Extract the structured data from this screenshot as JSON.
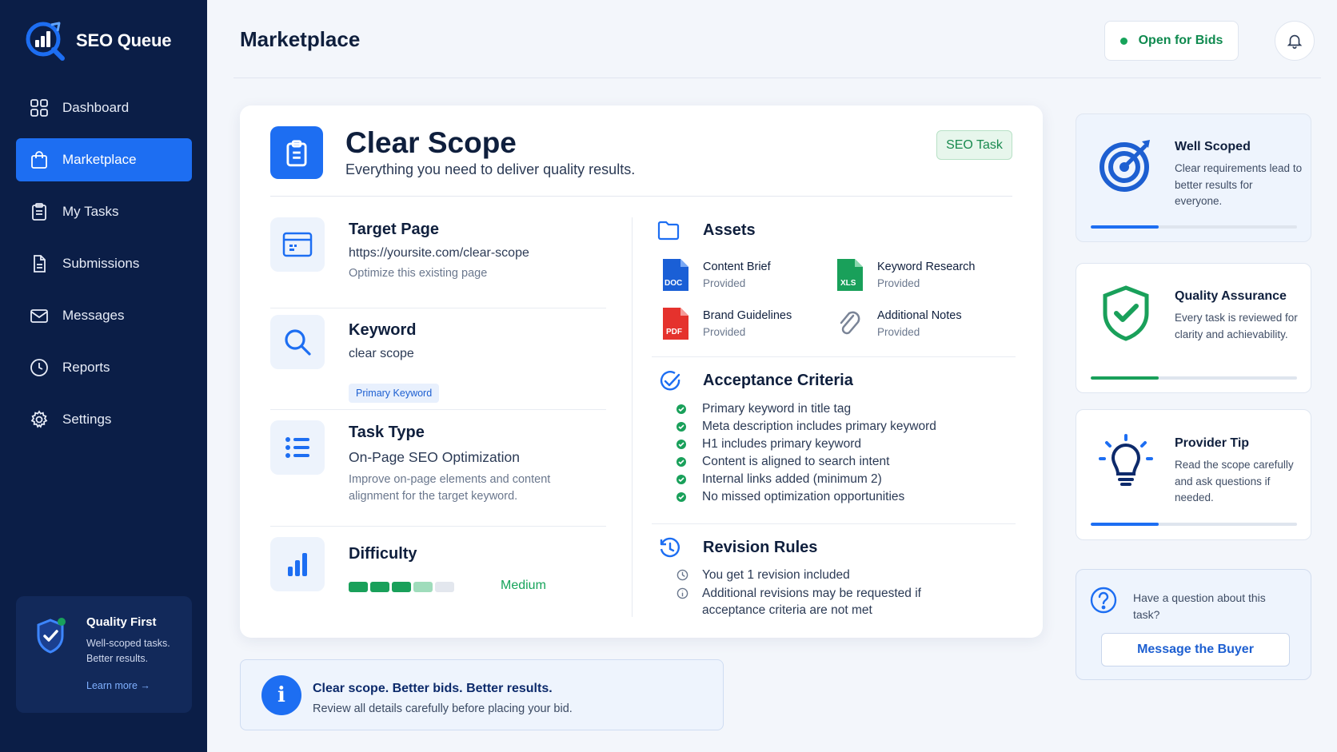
{
  "app": {
    "name": "SEO Queue"
  },
  "sidebar": {
    "items": [
      {
        "label": "Dashboard",
        "icon": "grid-icon",
        "active": false
      },
      {
        "label": "Marketplace",
        "icon": "shopping-bag-icon",
        "active": true
      },
      {
        "label": "My Tasks",
        "icon": "clipboard-icon",
        "active": false
      },
      {
        "label": "Submissions",
        "icon": "document-icon",
        "active": false
      },
      {
        "label": "Messages",
        "icon": "mail-icon",
        "active": false
      },
      {
        "label": "Reports",
        "icon": "clock-icon",
        "active": false
      },
      {
        "label": "Settings",
        "icon": "gear-icon",
        "active": false
      }
    ],
    "promo": {
      "title": "Quality First",
      "text": "Well-scoped tasks. Better results.",
      "link": "Learn more"
    }
  },
  "header": {
    "title": "Marketplace",
    "status": "Open for Bids"
  },
  "task": {
    "title": "Clear Scope",
    "subtitle": "Everything you need to deliver quality results.",
    "badge": "SEO Task",
    "target_page": {
      "label": "Target Page",
      "url": "https://yoursite.com/clear-scope",
      "note": "Optimize this existing page"
    },
    "keyword": {
      "label": "Keyword",
      "value": "clear scope",
      "badge": "Primary Keyword"
    },
    "task_type": {
      "label": "Task Type",
      "value": "On-Page SEO Optimization",
      "description": "Improve on-page elements and content alignment for the target keyword."
    },
    "difficulty": {
      "label": "Difficulty",
      "level": "Medium",
      "filled_segments": 3,
      "total_segments": 5
    },
    "assets": {
      "title": "Assets",
      "items": [
        {
          "name": "Content Brief",
          "status": "Provided",
          "type": "DOC"
        },
        {
          "name": "Keyword Research",
          "status": "Provided",
          "type": "XLS"
        },
        {
          "name": "Brand Guidelines",
          "status": "Provided",
          "type": "PDF"
        },
        {
          "name": "Additional Notes",
          "status": "Provided",
          "type": "paperclip"
        }
      ]
    },
    "acceptance": {
      "title": "Acceptance Criteria",
      "items": [
        "Primary keyword in title tag",
        "Meta description includes primary keyword",
        "H1 includes primary keyword",
        "Content is aligned to search intent",
        "Internal links added (minimum 2)",
        "No missed optimization opportunities"
      ]
    },
    "revision": {
      "title": "Revision Rules",
      "items": [
        "You get 1 revision included",
        "Additional revisions may be requested if acceptance criteria are not met"
      ]
    }
  },
  "info_bar": {
    "title": "Clear scope. Better bids. Better results.",
    "text": "Review all details carefully before placing your bid."
  },
  "side_cards": [
    {
      "title": "Well Scoped",
      "text": "Clear requirements lead to better results for everyone.",
      "icon": "target-icon",
      "progress": 0.33,
      "color": "#1d6ef2"
    },
    {
      "title": "Quality Assurance",
      "text": "Every task is reviewed for clarity and achievability.",
      "icon": "shield-check-icon",
      "progress": 0.33,
      "color": "#19a05a"
    },
    {
      "title": "Provider Tip",
      "text": "Read the scope carefully and ask questions if needed.",
      "icon": "lightbulb-icon",
      "progress": 0.33,
      "color": "#1d6ef2"
    }
  ],
  "question": {
    "text": "Have a question about this task?",
    "button": "Message the Buyer"
  }
}
